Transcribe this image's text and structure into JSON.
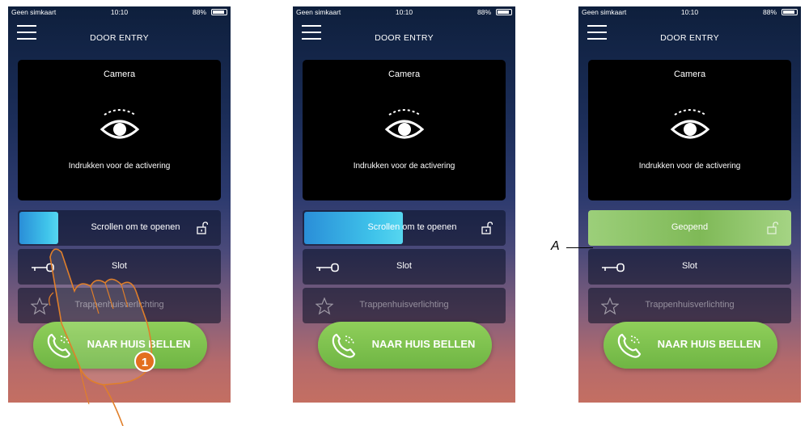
{
  "status": {
    "carrier": "Geen simkaart",
    "time": "10:10",
    "battery": "88%"
  },
  "header": {
    "title": "DOOR ENTRY"
  },
  "camera": {
    "title": "Camera",
    "hint": "Indrukken voor de activering"
  },
  "rows": {
    "open_label": "Scrollen om te openen",
    "opened_label": "Geopend",
    "lock_label": "Slot",
    "stairs_label": "Trappenhuisverlichting"
  },
  "call_button": {
    "label": "NAAR HUIS BELLEN"
  },
  "annotations": {
    "step": "1",
    "callout": "A"
  },
  "colors": {
    "call_green": "#7cc24e",
    "slider_blue": "#3fc3ea",
    "opened_green": "#8dc56a",
    "step_orange": "#e36f1e"
  }
}
